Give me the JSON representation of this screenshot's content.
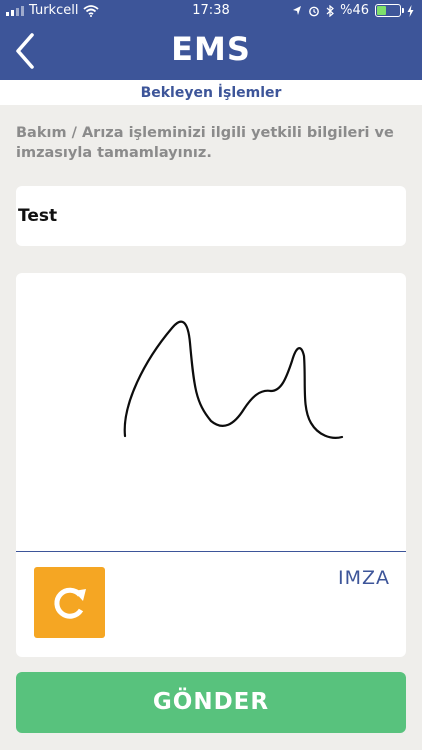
{
  "status_bar": {
    "carrier": "Turkcell",
    "time": "17:38",
    "battery_percent": "%46",
    "battery_level": 0.46,
    "icons": [
      "signal-icon",
      "wifi-icon",
      "location-icon",
      "alarm-icon",
      "bluetooth-icon",
      "battery-icon",
      "charging-icon"
    ]
  },
  "header": {
    "title": "EMS",
    "back_icon": "chevron-left-icon"
  },
  "subheader": {
    "title": "Bekleyen İşlemler"
  },
  "instruction": "Bakım / Arıza işleminizi ilgili yetkili bilgileri ve imzasıyla tamamlayınız.",
  "name_field": {
    "value": "Test",
    "placeholder": ""
  },
  "signature": {
    "label": "IMZA",
    "reset_icon": "refresh-icon"
  },
  "submit": {
    "label": "GÖNDER"
  },
  "colors": {
    "primary": "#3d5599",
    "background": "#efeeeb",
    "accent_orange": "#f5a623",
    "submit_green": "#58c27d",
    "muted_text": "#8b8b8b"
  }
}
